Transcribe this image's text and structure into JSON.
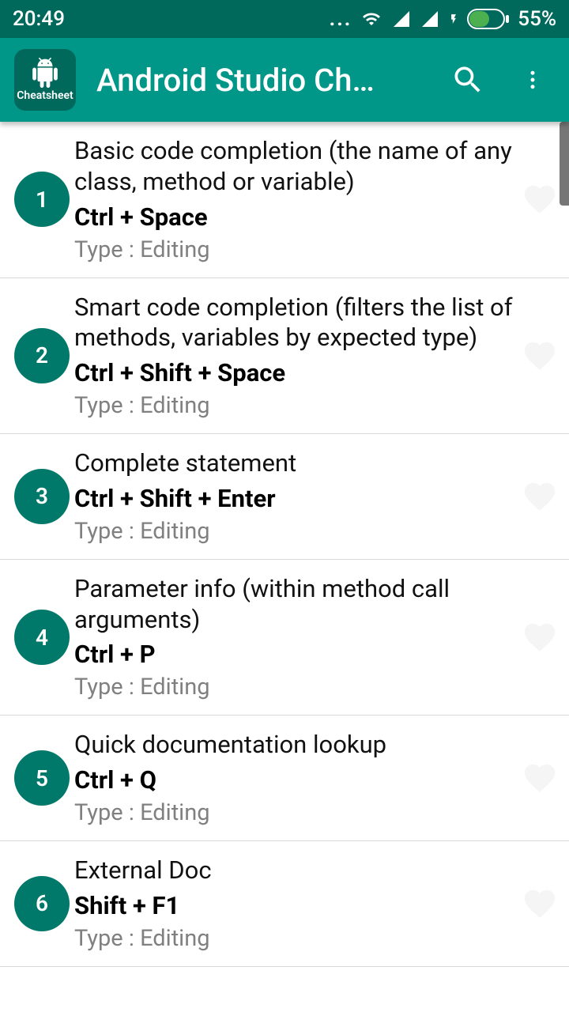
{
  "status": {
    "time": "20:49",
    "battery": "55%"
  },
  "appbar": {
    "title": "Android Studio Ch…",
    "icon_label": "Cheatsheet"
  },
  "items": [
    {
      "num": "1",
      "title": "Basic code completion (the name of any class, method or variable)",
      "shortcut": "Ctrl + Space",
      "type": "Type : Editing"
    },
    {
      "num": "2",
      "title": "Smart code completion (filters the list of methods, variables by expected type)",
      "shortcut": "Ctrl + Shift + Space",
      "type": "Type : Editing"
    },
    {
      "num": "3",
      "title": "Complete statement",
      "shortcut": "Ctrl + Shift + Enter",
      "type": "Type : Editing"
    },
    {
      "num": "4",
      "title": "Parameter info (within method call arguments)",
      "shortcut": "Ctrl + P",
      "type": "Type : Editing"
    },
    {
      "num": "5",
      "title": "Quick documentation lookup",
      "shortcut": "Ctrl + Q",
      "type": "Type : Editing"
    },
    {
      "num": "6",
      "title": "External Doc",
      "shortcut": "Shift + F1",
      "type": "Type : Editing"
    }
  ]
}
